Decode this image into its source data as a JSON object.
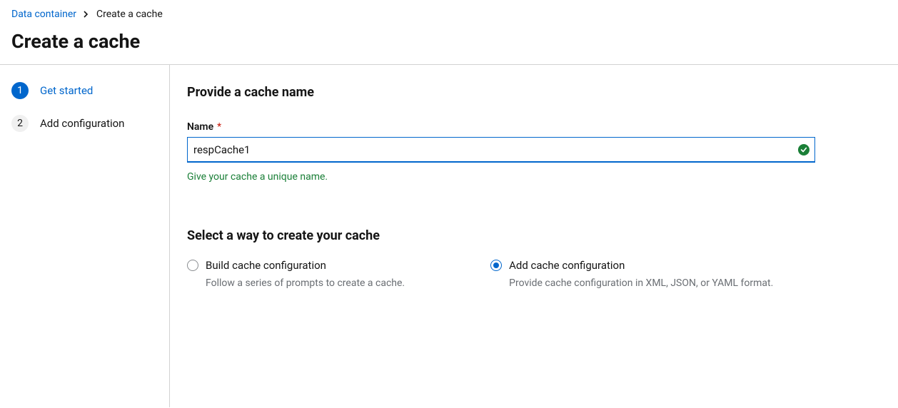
{
  "breadcrumb": {
    "parent": "Data container",
    "current": "Create a cache"
  },
  "page_title": "Create a cache",
  "sidebar": {
    "steps": [
      {
        "num": "1",
        "label": "Get started",
        "active": true
      },
      {
        "num": "2",
        "label": "Add configuration",
        "active": false
      }
    ]
  },
  "form": {
    "section1_title": "Provide a cache name",
    "name_label": "Name",
    "name_value": "respCache1",
    "name_help": "Give your cache a unique name.",
    "section2_title": "Select a way to create your cache",
    "options": {
      "build": {
        "label": "Build cache configuration",
        "desc": "Follow a series of prompts to create a cache."
      },
      "add": {
        "label": "Add cache configuration",
        "desc": "Provide cache configuration in XML, JSON, or YAML format."
      }
    }
  }
}
